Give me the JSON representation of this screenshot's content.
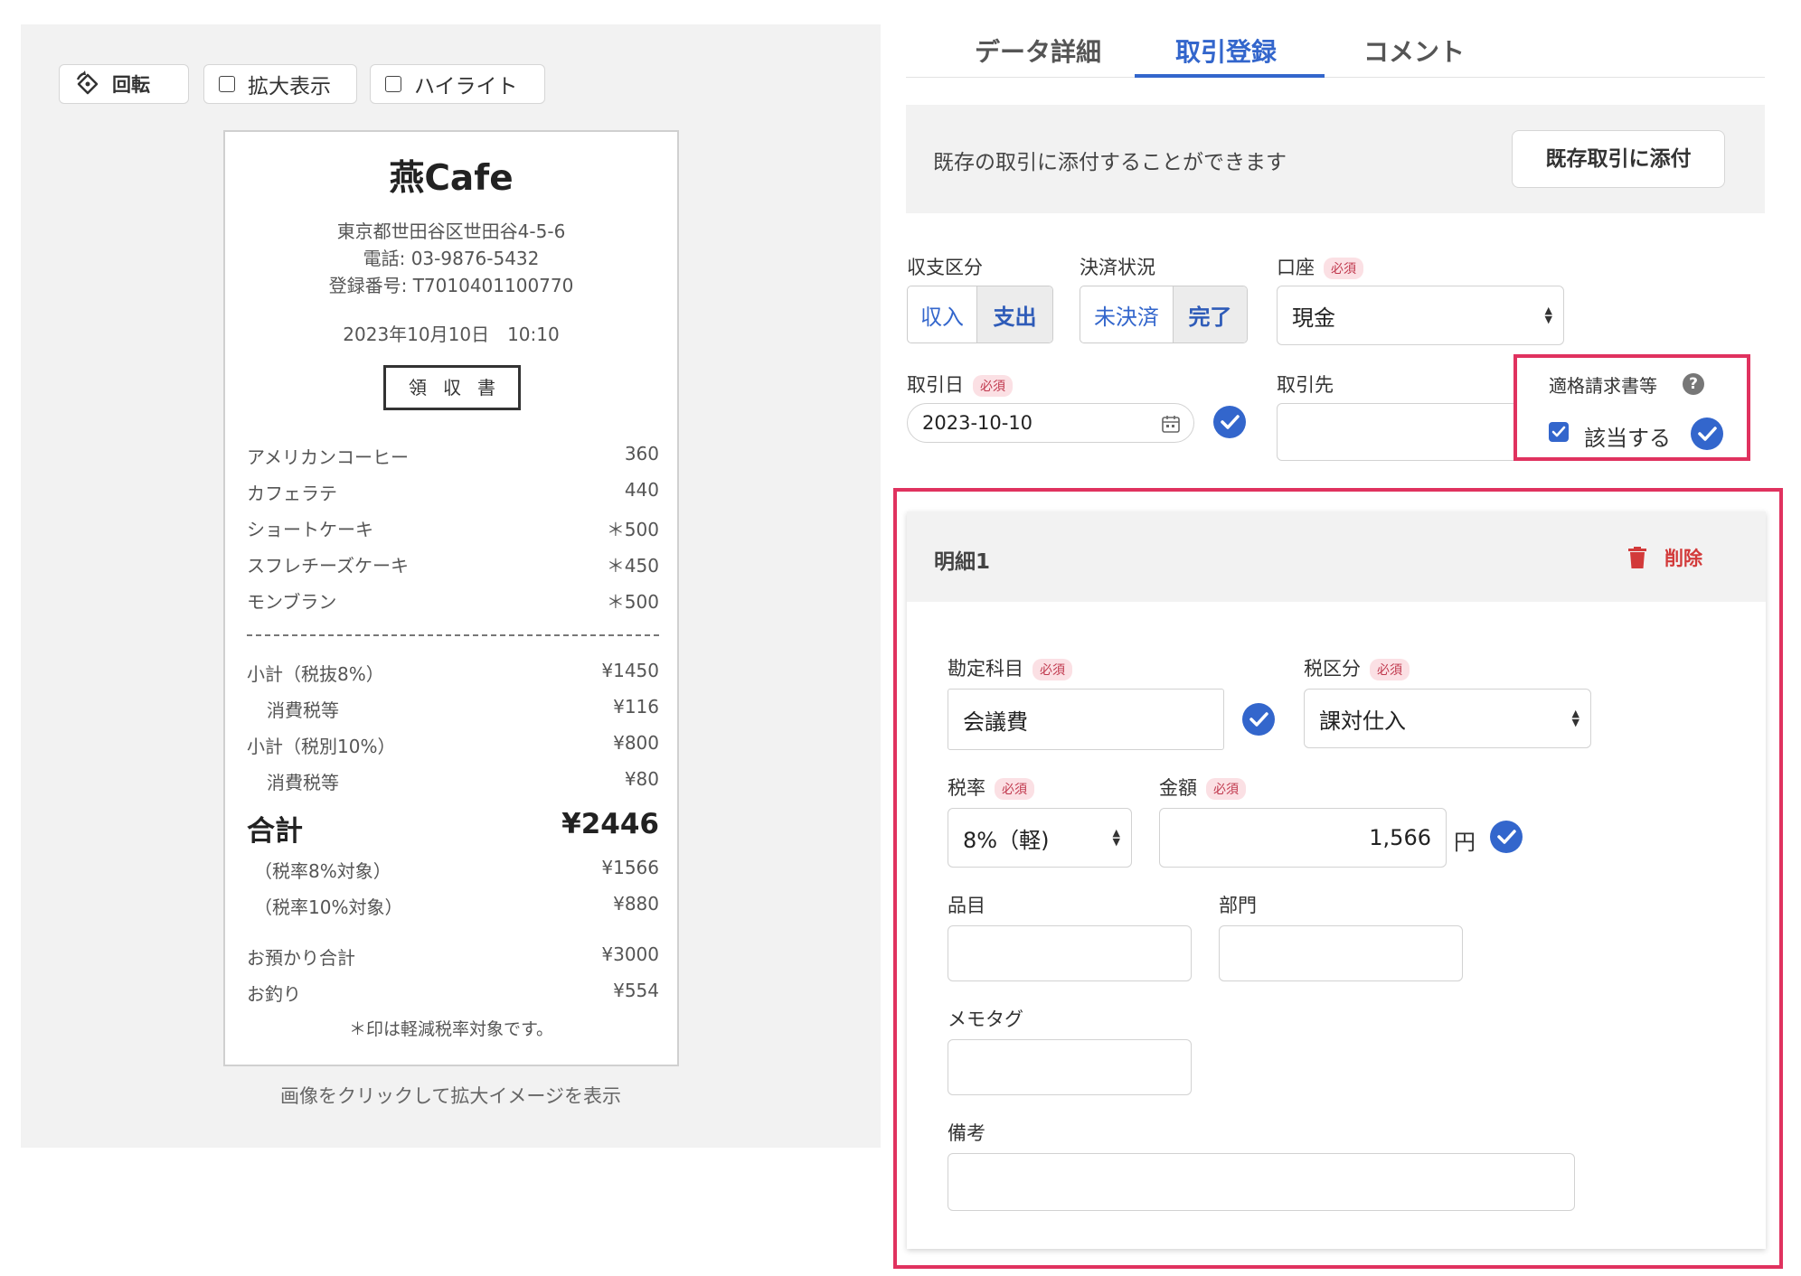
{
  "toolbar": {
    "rotate_label": "回転",
    "zoom_label": "拡大表示",
    "highlight_label": "ハイライト"
  },
  "receipt": {
    "store": "燕Cafe",
    "address": "東京都世田谷区世田谷4-5-6",
    "phone": "電話: 03-9876-5432",
    "registration": "登録番号: T7010401100770",
    "datetime": "2023年10月10日　10:10",
    "doc_title": "領収書",
    "items": [
      {
        "name": "アメリカンコーヒー",
        "price": "360"
      },
      {
        "name": "カフェラテ",
        "price": "440"
      },
      {
        "name": "ショートケーキ",
        "price": "＊500"
      },
      {
        "name": "スフレチーズケーキ",
        "price": "＊450"
      },
      {
        "name": "モンブラン",
        "price": "＊500"
      }
    ],
    "summary": [
      {
        "name": "小計（税抜8%）",
        "value": "¥1450"
      },
      {
        "name": "消費税等",
        "value": "¥116"
      },
      {
        "name": "小計（税別10%）",
        "value": "¥800"
      },
      {
        "name": "消費税等",
        "value": "¥80"
      }
    ],
    "total_label": "合計",
    "total_value": "¥2446",
    "tax_breakdown": [
      {
        "name": "（税率8%対象）",
        "value": "¥1566"
      },
      {
        "name": "（税率10%対象）",
        "value": "¥880"
      }
    ],
    "payment": [
      {
        "name": "お預かり合計",
        "value": "¥3000"
      },
      {
        "name": "お釣り",
        "value": "¥554"
      }
    ],
    "note": "＊印は軽減税率対象です。"
  },
  "caption": "画像をクリックして拡大イメージを表示",
  "tabs": [
    "データ詳細",
    "取引登録",
    "コメント"
  ],
  "attach": {
    "text": "既存の取引に添付することができます",
    "button": "既存取引に添付"
  },
  "form": {
    "required": "必須",
    "income_type": {
      "label": "収支区分",
      "options": [
        "収入",
        "支出"
      ],
      "selected": "支出"
    },
    "settlement": {
      "label": "決済状況",
      "options": [
        "未決済",
        "完了"
      ],
      "selected": "完了"
    },
    "account": {
      "label": "口座",
      "value": "現金"
    },
    "date": {
      "label": "取引日",
      "value": "2023-10-10"
    },
    "partner": {
      "label": "取引先",
      "value": ""
    },
    "invoice": {
      "label": "適格請求書等",
      "help": "?",
      "checkbox_label": "該当する",
      "checked": true
    }
  },
  "detail": {
    "title": "明細1",
    "delete": "削除",
    "account_item": {
      "label": "勘定科目",
      "value": "会議費"
    },
    "tax_category": {
      "label": "税区分",
      "value": "課対仕入"
    },
    "tax_rate": {
      "label": "税率",
      "value": "8%（軽)"
    },
    "amount": {
      "label": "金額",
      "value": "1,566",
      "unit": "円"
    },
    "item": {
      "label": "品目"
    },
    "department": {
      "label": "部門"
    },
    "memo_tag": {
      "label": "メモタグ"
    },
    "remarks": {
      "label": "備考"
    }
  },
  "colors": {
    "accent": "#3366cc",
    "highlight_border": "#e0325f",
    "required_bg": "#fbe0e4",
    "delete": "#d23a3a"
  }
}
